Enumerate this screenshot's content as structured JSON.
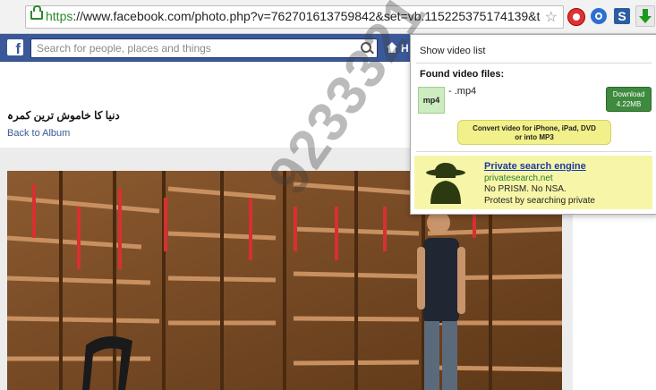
{
  "browser": {
    "url_scheme": "https",
    "url_rest": "://www.facebook.com/photo.php?v=762701613759842&set=vb.115225375174139&t",
    "extensions": [
      "record-icon",
      "sync-icon",
      "s-icon",
      "download-arrow-icon"
    ]
  },
  "facebook": {
    "logo": "f",
    "search_placeholder": "Search for people, places and things",
    "home_label": "H"
  },
  "page": {
    "photo_title": "دنیا کا خاموش ترین کمرہ",
    "back_link": "Back to Album"
  },
  "popup": {
    "show_list": "Show video list",
    "found_heading": "Found video files:",
    "file_badge": "mp4",
    "file_name": "- .mp4",
    "download_label": "Download",
    "download_size": "4.22MB",
    "convert_line1": "Convert video for iPhone, iPad, DVD",
    "convert_line2": "or into MP3",
    "ad": {
      "title": "Private search engine",
      "domain": "privatesearch.net",
      "line1": "No PRISM. No NSA.",
      "line2": "Protest by searching private"
    }
  },
  "watermark": "9233321",
  "colors": {
    "facebook_blue": "#3b5998",
    "download_green": "#3e8a3e",
    "convert_yellow": "#f1f08a",
    "ad_yellow": "#f7f6a8"
  }
}
